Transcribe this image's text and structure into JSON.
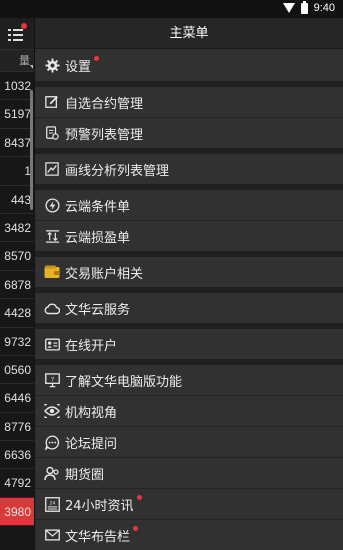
{
  "status_bar": {
    "time": "9:40"
  },
  "background_list": {
    "header_fragment": "量",
    "values": [
      "1032",
      "5197",
      "8437",
      "1",
      "443",
      "3482",
      "8570",
      "6878",
      "4428",
      "9732",
      "0560",
      "6446",
      "8776",
      "6636",
      "4792",
      "3980"
    ]
  },
  "drawer": {
    "title": "主菜单",
    "items": [
      {
        "label": "设置",
        "icon": "gear-icon",
        "badge": true
      },
      {
        "label": "自选合约管理",
        "icon": "edit-icon",
        "badge": false
      },
      {
        "label": "预警列表管理",
        "icon": "alert-list-icon",
        "badge": false
      },
      {
        "label": "画线分析列表管理",
        "icon": "line-chart-icon",
        "badge": false
      },
      {
        "label": "云端条件单",
        "icon": "lightning-icon",
        "badge": false
      },
      {
        "label": "云端损盈单",
        "icon": "stop-profit-icon",
        "badge": false
      },
      {
        "label": "交易账户相关",
        "icon": "wallet-icon",
        "badge": false
      },
      {
        "label": "文华云服务",
        "icon": "cloud-icon",
        "badge": false
      },
      {
        "label": "在线开户",
        "icon": "id-card-icon",
        "badge": false
      },
      {
        "label": "了解文华电脑版功能",
        "icon": "monitor-icon",
        "badge": false
      },
      {
        "label": "机构视角",
        "icon": "eye-icon",
        "badge": false
      },
      {
        "label": "论坛提问",
        "icon": "chat-icon",
        "badge": false
      },
      {
        "label": "期货圈",
        "icon": "people-icon",
        "badge": false
      },
      {
        "label": "24小时资讯",
        "icon": "news-icon",
        "badge": true
      },
      {
        "label": "文华布告栏",
        "icon": "mail-icon",
        "badge": true
      }
    ]
  },
  "colors": {
    "badge": "#e8363a",
    "wallet": "#e6b422",
    "drawer_bg": "#313131"
  }
}
